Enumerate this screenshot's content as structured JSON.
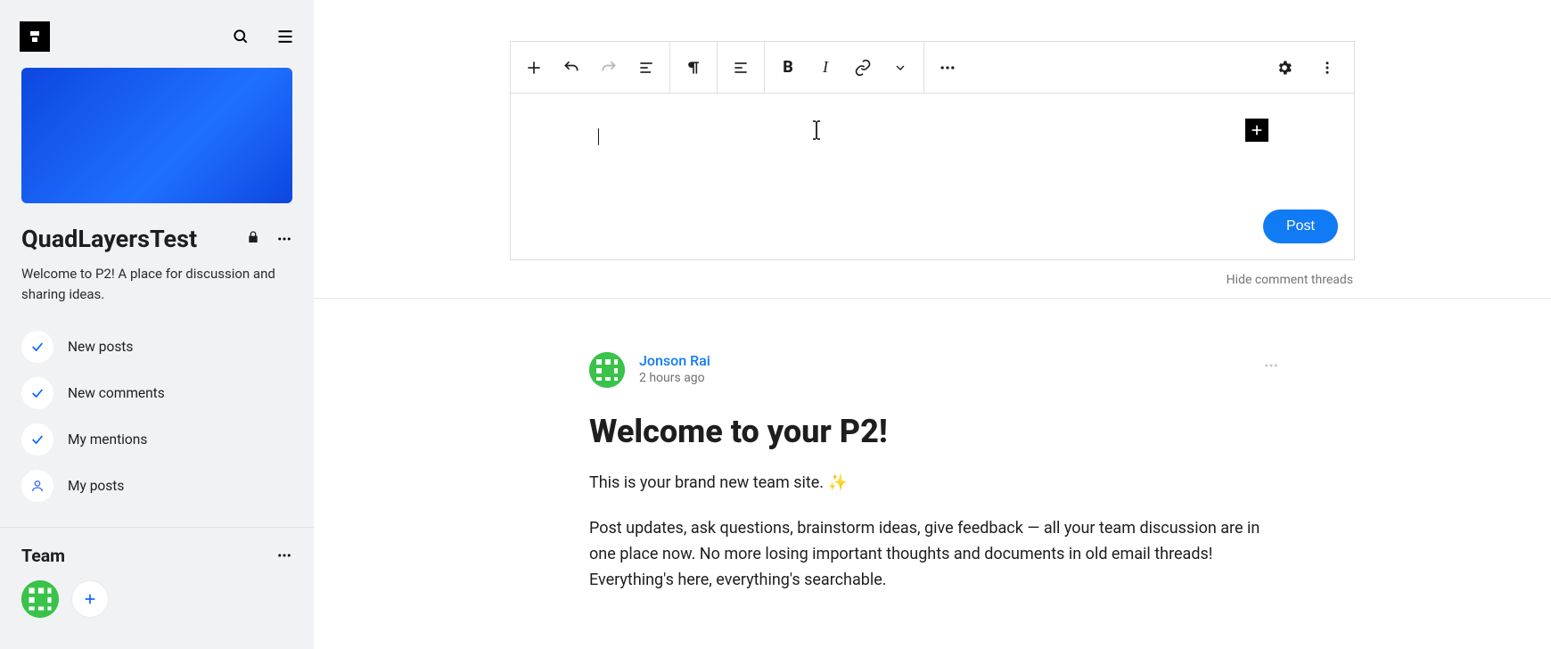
{
  "sidebar": {
    "site_title": "QuadLayersTest",
    "site_desc": "Welcome to P2! A place for discussion and sharing ideas.",
    "filters": [
      {
        "label": "New posts",
        "icon": "check"
      },
      {
        "label": "New comments",
        "icon": "check"
      },
      {
        "label": "My mentions",
        "icon": "check"
      },
      {
        "label": "My posts",
        "icon": "user"
      }
    ],
    "team_title": "Team"
  },
  "editor": {
    "post_button": "Post",
    "hide_threads": "Hide comment threads"
  },
  "feed_post": {
    "author": "Jonson Rai",
    "time": "2 hours ago",
    "title": "Welcome to your P2!",
    "para1": "This is your brand new team site. ✨",
    "para2": "Post updates, ask questions, brainstorm ideas, give feedback — all your team discussion are in one place now. No more losing important thoughts and documents in old email threads! Everything's here, everything's searchable."
  }
}
